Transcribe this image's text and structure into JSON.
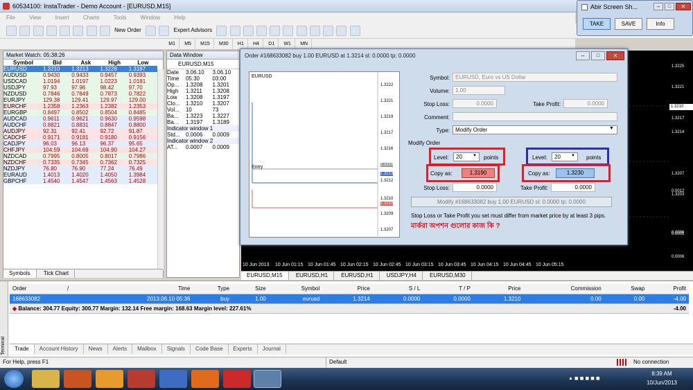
{
  "window": {
    "title": "60534100: InstaTrader - Demo Account - [EURUSD,M15]"
  },
  "menu": [
    "File",
    "View",
    "Insert",
    "Charts",
    "Tools",
    "Window",
    "Help"
  ],
  "toolbar": {
    "new_order": "New Order",
    "expert_advisors": "Expert Advisors"
  },
  "timeframes": [
    "M1",
    "M5",
    "M15",
    "M30",
    "H1",
    "H4",
    "D1",
    "W1",
    "MN"
  ],
  "market_watch": {
    "title": "Market Watch: 05:38:26",
    "headers": [
      "Symbol",
      "Bid",
      "Ask",
      "High",
      "Low"
    ],
    "rows": [
      [
        "EURUSD",
        "1.3210",
        "1.3213",
        "1.3228",
        "1.3187"
      ],
      [
        "AUDUSD",
        "0.9430",
        "0.9433",
        "0.9457",
        "0.9393"
      ],
      [
        "USDCAD",
        "1.0194",
        "1.0197",
        "1.0223",
        "1.0181"
      ],
      [
        "USDJPY",
        "97.93",
        "97.96",
        "98.42",
        "97.70"
      ],
      [
        "NZDUSD",
        "0.7846",
        "0.7849",
        "0.7873",
        "0.7822"
      ],
      [
        "EURJPY",
        "129.38",
        "129.41",
        "129.97",
        "129.00"
      ],
      [
        "EURCHF",
        "1.2358",
        "1.2363",
        "1.2382",
        "1.2353"
      ],
      [
        "EURGBP",
        "0.8497",
        "0.8502",
        "0.8504",
        "0.8485"
      ],
      [
        "AUDCAD",
        "0.9611",
        "0.9621",
        "0.9630",
        "0.9598"
      ],
      [
        "AUDCHF",
        "0.8821",
        "0.8831",
        "0.8847",
        "0.8800"
      ],
      [
        "AUDJPY",
        "92.31",
        "92.41",
        "92.72",
        "91.87"
      ],
      [
        "CADCHF",
        "0.9171",
        "0.9181",
        "0.9180",
        "0.9156"
      ],
      [
        "CADJPY",
        "96.03",
        "96.13",
        "96.37",
        "95.65"
      ],
      [
        "CHFJPY",
        "104.59",
        "104.69",
        "104.90",
        "104.27"
      ],
      [
        "NZDCAD",
        "0.7995",
        "0.8005",
        "0.8017",
        "0.7986"
      ],
      [
        "NZDCHF",
        "0.7335",
        "0.7345",
        "0.7362",
        "0.7325"
      ],
      [
        "NZDJPY",
        "76.80",
        "76.90",
        "77.24",
        "76.49"
      ],
      [
        "EURAUD",
        "1.4013",
        "1.4020",
        "1.4050",
        "1.3984"
      ],
      [
        "GBPCHF",
        "1.4540",
        "1.4547",
        "1.4563",
        "1.4528"
      ]
    ],
    "tabs": [
      "Symbols",
      "Tick Chart"
    ]
  },
  "data_window": {
    "title": "Data Window",
    "symbol": "EURUSD,M15",
    "rows": [
      [
        "Date",
        "3.06.10",
        "3.06.10"
      ],
      [
        "Time",
        "05:30",
        "03:00"
      ],
      [
        "Op...",
        "1.3208",
        "1.3201"
      ],
      [
        "High",
        "1.3211",
        "1.3208"
      ],
      [
        "Low",
        "1.3208",
        "1.3197"
      ],
      [
        "Clo...",
        "1.3210",
        "1.3207"
      ],
      [
        "Vol...",
        "10",
        "73"
      ],
      [
        "Ba...",
        "1.3223",
        "1.3227"
      ],
      [
        "Ba...",
        "1.3197",
        "1.3189"
      ]
    ],
    "ind1": "Indicator window 1",
    "ind1_row": [
      "Std...",
      "0.0006",
      "0.0009"
    ],
    "ind2": "Indicator window 2",
    "ind2_row": [
      "AT...",
      "0.0007",
      "0.0009"
    ]
  },
  "chart": {
    "right_prices": [
      "1.3225",
      "1.3221",
      "1.3217",
      "1.3214",
      "1.3210",
      "1.3207",
      "1.3203",
      "0.0012",
      "0.0006",
      "0.0001",
      "0.0006"
    ],
    "time_labels": [
      "10 Jun 2013",
      "10 Jun 01:15",
      "10 Jun 01:45",
      "10 Jun 02:15",
      "10 Jun 02:45",
      "10 Jun 03:15",
      "10 Jun 03:45",
      "10 Jun 04:15",
      "10 Jun 04:45",
      "10 Jun 05:15"
    ],
    "tabs": [
      "EURUSD,M15",
      "EURUSD,H1",
      "EURUSD,H1",
      "USDJPY,H4",
      "EURUSD,M30"
    ]
  },
  "screenshot_tool": {
    "title": "Abir Screen Sh...",
    "take": "TAKE",
    "save": "SAVE",
    "info": "Info"
  },
  "order_dialog": {
    "title": "Order #168633082 buy 1.00 EURUSD at 1.3214 sl: 0.0000 tp: 0.0000",
    "mini_chart_title": "EURUSD",
    "entry_label": "Entry",
    "mini_prices": [
      "1.3222",
      "1.3221",
      "1.3219",
      "1.3217",
      "1.3216",
      "1.3214",
      "1.3213",
      "1.3212",
      "1.3210",
      "1.3210",
      "1.3209",
      "1.3207"
    ],
    "symbol_label": "Symbol:",
    "symbol_value": "EURUSD, Euro vs US Dollar",
    "volume_label": "Volume:",
    "volume_value": "1.00",
    "sl_label": "Stop Loss:",
    "sl_value": "0.0000",
    "tp_label": "Take Profit:",
    "tp_value": "0.0000",
    "comment_label": "Comment:",
    "type_label": "Type:",
    "type_value": "Modify Order",
    "modify_group": "Modify Order",
    "level_label": "Level:",
    "level_left": "20",
    "level_right": "20",
    "points": "points",
    "copy_as": "Copy as:",
    "copy_left": "1.3190",
    "copy_right": "1.3230",
    "sl2_label": "Stop Loss:",
    "sl2_value": "0.0000",
    "tp2_label": "Take Profit:",
    "tp2_value": "0.0000",
    "modify_button": "Modify #168633082 buy 1.00 EURUSD sl: 0.0000 tp: 0.0000",
    "warning": "Stop Loss or Take Profit you set must differ from market price by at least 3 pips.",
    "annotation": "মার্করা অপশন গুলোর কাজ কি ?"
  },
  "terminal": {
    "side_label": "Terminal",
    "headers": [
      "Order",
      "/",
      "Time",
      "Type",
      "Size",
      "Symbol",
      "Price",
      "S / L",
      "T / P",
      "Price",
      "Commission",
      "Swap",
      "Profit"
    ],
    "row": [
      "168633082",
      "2013.06.10 05:36",
      "buy",
      "1.00",
      "eurusd",
      "1.3214",
      "0.0000",
      "0.0000",
      "1.3210",
      "0.00",
      "0.00",
      "-4.00"
    ],
    "balance": "Balance: 304.77  Equity: 300.77  Margin: 132.14  Free margin: 168.63  Margin level: 227.61%",
    "balance_profit": "-4.00",
    "tabs": [
      "Trade",
      "Account History",
      "News",
      "Alerts",
      "Mailbox",
      "Signals",
      "Code Base",
      "Experts",
      "Journal"
    ]
  },
  "status": {
    "help": "For Help, press F1",
    "profile": "Default",
    "connection": "No connection"
  },
  "taskbar": {
    "time": "8:39 AM",
    "date": "10/Jun/2013"
  },
  "colors": {
    "red_box": "#e31c25",
    "blue_box": "#2b2bb8",
    "sell_btn": "#f08080",
    "buy_btn": "#9cc3ec"
  }
}
